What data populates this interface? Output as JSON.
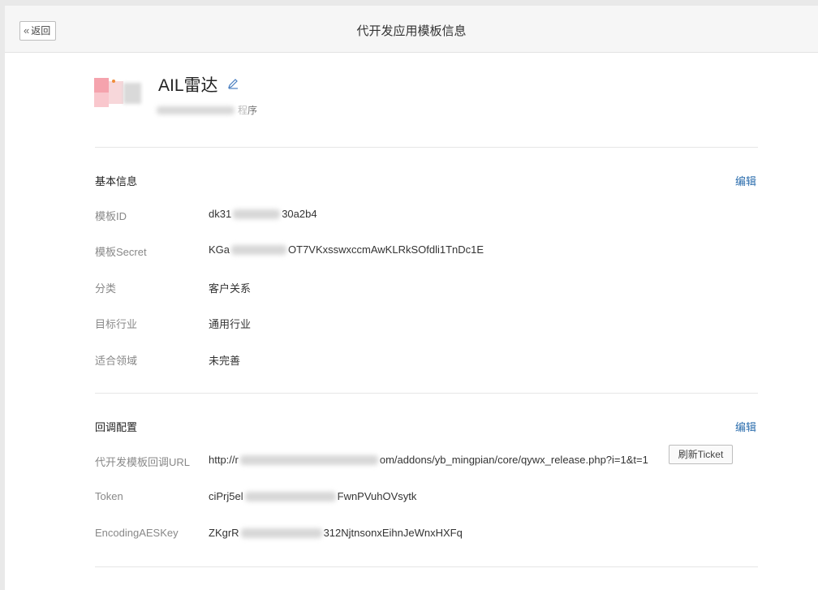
{
  "header": {
    "back_label": "返回",
    "title": "代开发应用模板信息"
  },
  "app": {
    "name": "AIL雷达",
    "subtitle_visible": "序",
    "subtitle_visible_2": "程"
  },
  "basic": {
    "title": "基本信息",
    "edit_label": "编辑",
    "rows": [
      {
        "label": "模板ID",
        "value_prefix": "dk31",
        "value_suffix": "30a2b4"
      },
      {
        "label": "模板Secret",
        "value_prefix": "KGa",
        "value_suffix": "OT7VKxsswxccmAwKLRkSOfdli1TnDc1E"
      },
      {
        "label": "分类",
        "value": "客户关系"
      },
      {
        "label": "目标行业",
        "value": "通用行业"
      },
      {
        "label": "适合领域",
        "value": "未完善"
      }
    ]
  },
  "callback": {
    "title": "回调配置",
    "edit_label": "编辑",
    "refresh_label": "刷新Ticket",
    "rows": [
      {
        "label": "代开发模板回调URL",
        "value_prefix": "http://r",
        "value_suffix": "om/addons/yb_mingpian/core/qywx_release.php?i=1&t=1"
      },
      {
        "label": "Token",
        "value_prefix": "ciPrj5el",
        "value_suffix": "FwnPVuhOVsytk"
      },
      {
        "label": "EncodingAESKey",
        "value_prefix": "ZKgrR",
        "value_suffix": "312NjtnsonxEihnJeWnxHXFq"
      }
    ]
  }
}
